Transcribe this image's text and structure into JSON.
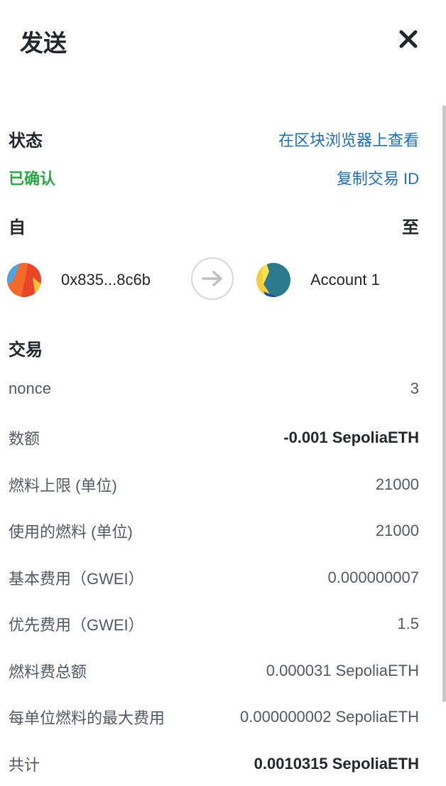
{
  "header": {
    "title": "发送"
  },
  "status": {
    "label": "状态",
    "view_on_explorer": "在区块浏览器上查看",
    "value": "已确认",
    "copy_tx_id": "复制交易 ID"
  },
  "parties": {
    "from_label": "自",
    "to_label": "至",
    "from_address": "0x835...8c6b",
    "to_name": "Account 1"
  },
  "transaction": {
    "title": "交易",
    "rows": [
      {
        "label": "nonce",
        "value": "3"
      },
      {
        "label": "数额",
        "value": "-0.001 SepoliaETH"
      },
      {
        "label": "燃料上限 (单位)",
        "value": "21000"
      },
      {
        "label": "使用的燃料 (单位)",
        "value": "21000"
      },
      {
        "label": "基本费用（GWEI）",
        "value": "0.000000007"
      },
      {
        "label": "优先费用（GWEI）",
        "value": "1.5"
      },
      {
        "label": "燃料费总额",
        "value": "0.000031 SepoliaETH"
      },
      {
        "label": "每单位燃料的最大费用",
        "value": "0.000000002 SepoliaETH"
      },
      {
        "label": "共计",
        "value": "0.0010315 SepoliaETH"
      }
    ]
  },
  "colors": {
    "link": "#1e6fbf",
    "success": "#28a745",
    "text": "#24272a",
    "muted": "#535a61"
  },
  "icons": {
    "close": "close-icon",
    "arrow": "arrow-right-icon",
    "from_avatar": "jazzicon-avatar",
    "to_avatar": "jazzicon-avatar"
  }
}
